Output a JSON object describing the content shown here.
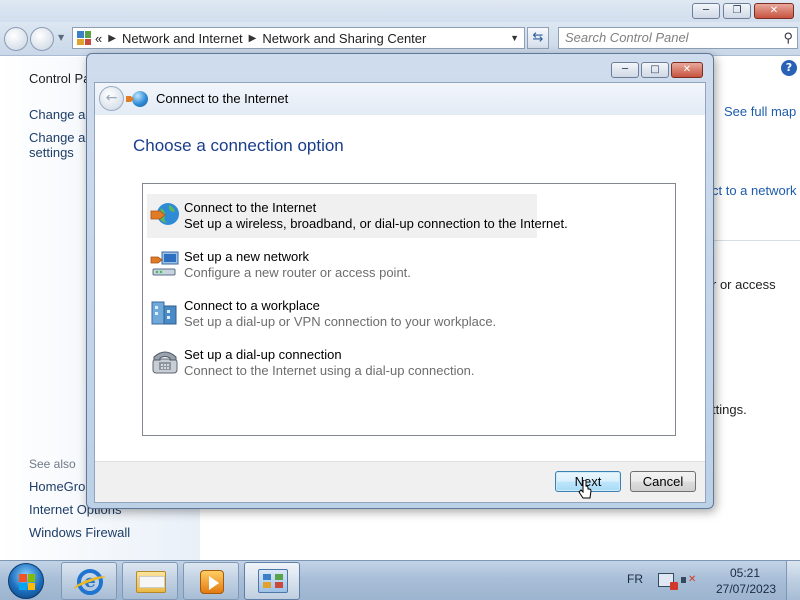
{
  "background_window": {
    "address": {
      "overflow": "«",
      "crumbs": [
        "Network and Internet",
        "Network and Sharing Center"
      ]
    },
    "search_placeholder": "Search Control Panel",
    "sidebar": {
      "control_panel": "Control Pa",
      "change_adapter": "Change ad",
      "change_advanced_1": "Change ad",
      "change_advanced_2": "settings",
      "see_also": "See also",
      "items": [
        "HomeGrou",
        "Internet Options",
        "Windows Firewall"
      ]
    },
    "main": {
      "see_full_map": "See full map",
      "connect_to_network": "ct to a network",
      "or_access": "r or access",
      "settings": "ttings."
    }
  },
  "dialog": {
    "title": "Connect to the Internet",
    "heading": "Choose a connection option",
    "options": [
      {
        "title": "Connect to the Internet",
        "description": "Set up a wireless, broadband, or dial-up connection to the Internet.",
        "icon": "globe-icon",
        "selected": true
      },
      {
        "title": "Set up a new network",
        "description": "Configure a new router or access point.",
        "icon": "network-icon",
        "selected": false
      },
      {
        "title": "Connect to a workplace",
        "description": "Set up a dial-up or VPN connection to your workplace.",
        "icon": "workplace-icon",
        "selected": false
      },
      {
        "title": "Set up a dial-up connection",
        "description": "Connect to the Internet using a dial-up connection.",
        "icon": "phone-icon",
        "selected": false
      }
    ],
    "next_label": "Next",
    "cancel_label": "Cancel"
  },
  "taskbar": {
    "language": "FR",
    "time": "05:21",
    "date": "27/07/2023"
  },
  "colors": {
    "heading": "#1a3d8b",
    "link": "#1c5cab",
    "taskbar": "#a9bfd8"
  }
}
